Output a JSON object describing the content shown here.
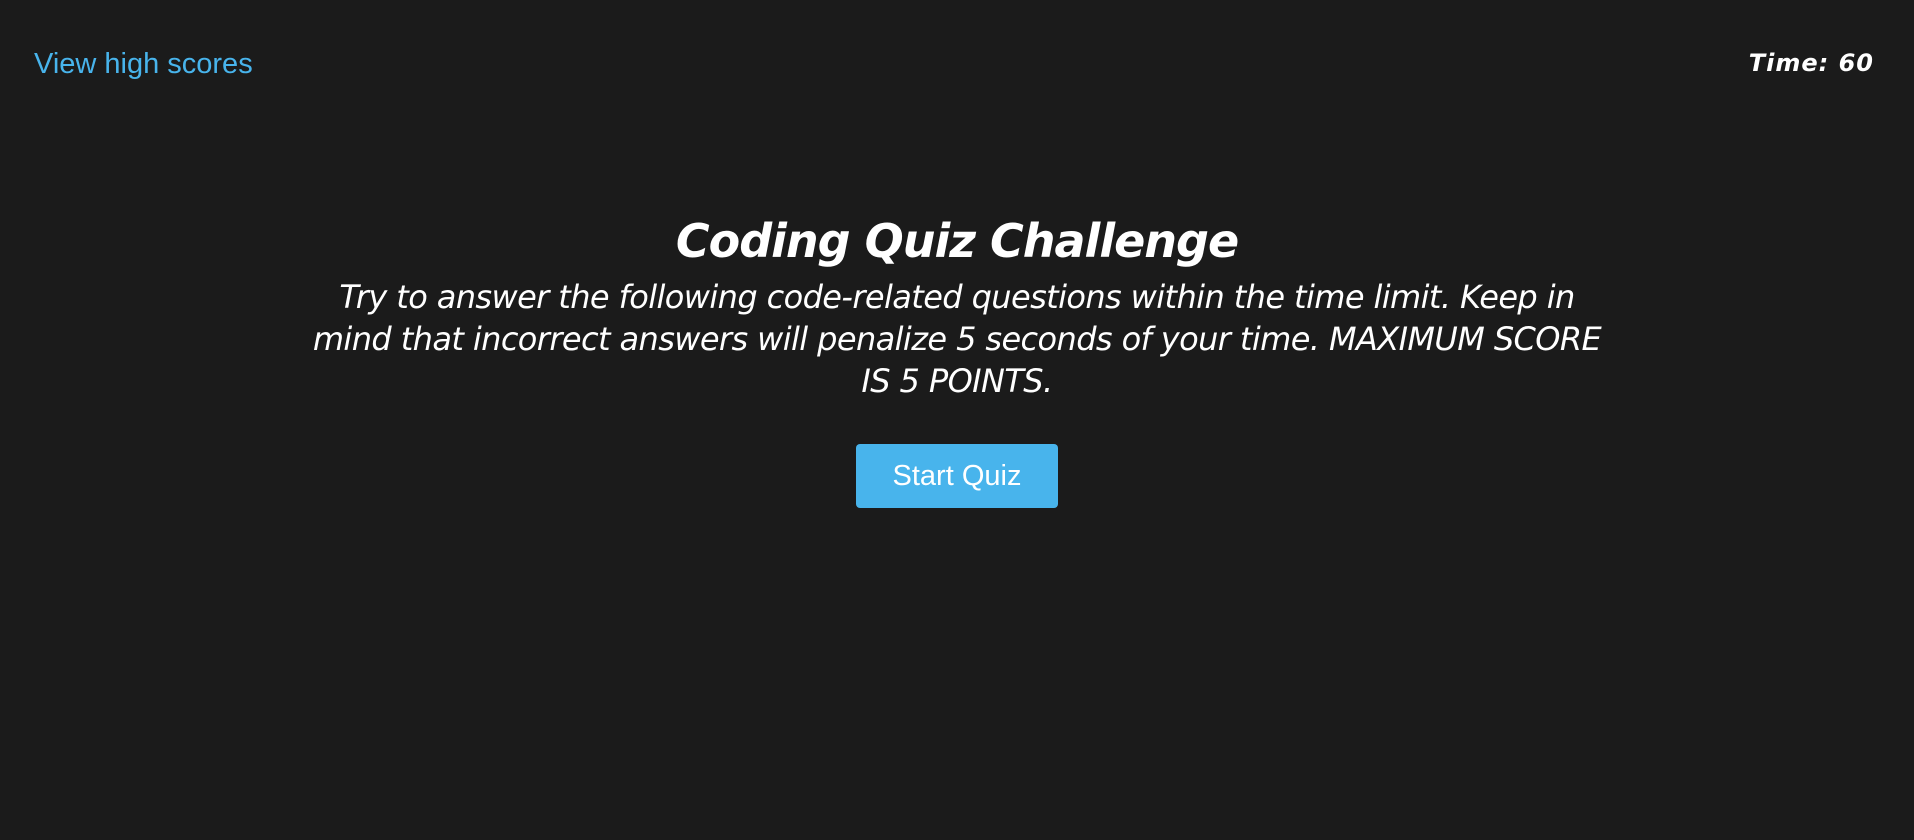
{
  "header": {
    "high_scores_link": "View high scores",
    "timer_label": "Time: ",
    "timer_value": "60"
  },
  "main": {
    "title": "Coding Quiz Challenge",
    "description": "Try to answer the following code-related questions within the time limit. Keep in mind that incorrect answers will penalize 5 seconds of your time. MAXIMUM SCORE IS 5 POINTS.",
    "start_button_label": "Start Quiz"
  },
  "colors": {
    "background": "#1b1b1b",
    "accent": "#48b4ec",
    "text": "#ffffff"
  }
}
